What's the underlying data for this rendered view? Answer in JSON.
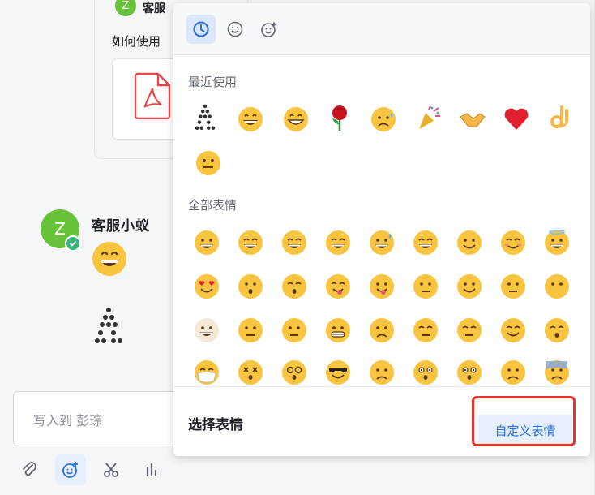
{
  "chat": {
    "prev_sender_initial": "Z",
    "prev_sender_name": "客服",
    "prev_question": "如何使用",
    "sender_initial": "Z",
    "sender_name": "客服小蚁",
    "compose_placeholder": "写入到 彭琮"
  },
  "toolbar": {
    "items": [
      {
        "icon": "paperclip-icon"
      },
      {
        "icon": "emoji-add-icon",
        "active": true
      },
      {
        "icon": "scissors-icon"
      },
      {
        "icon": "chart-bars-icon"
      }
    ]
  },
  "emoji_panel": {
    "tabs": [
      {
        "icon": "clock-icon",
        "active": true
      },
      {
        "icon": "smiley-icon"
      },
      {
        "icon": "smiley-sparkle-icon"
      }
    ],
    "recent_title": "最近使用",
    "all_title": "全部表情",
    "footer_title": "选择表情",
    "custom_button": "自定义表情"
  },
  "colors": {
    "accent": "#2a6ee0",
    "avatar_green": "#67c23a",
    "highlight_red": "#e8322e",
    "emoji_yellow": "#f9c440"
  }
}
